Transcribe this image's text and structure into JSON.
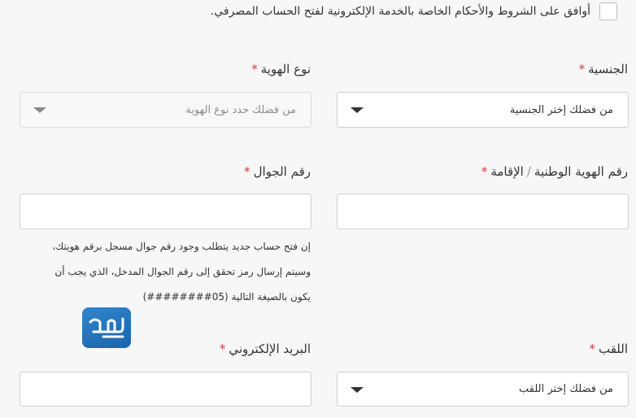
{
  "terms": {
    "text": "أوافق على الشروط والأحكام الخاصة بالخدمة الإلكترونية لفتح الحساب المصرفي."
  },
  "nationality": {
    "label": "الجنسية",
    "required_mark": "*",
    "placeholder": "من فضلك إختر الجنسية"
  },
  "id_type": {
    "label": "نوع الهوية",
    "required_mark": "*",
    "placeholder": "من فضلك حدد نوع الهوية"
  },
  "national_id": {
    "label_part1": "رقم الهوية الوطنية",
    "separator": "/",
    "label_part2": "الإقامة",
    "required_mark": "*",
    "value": ""
  },
  "mobile": {
    "label": "رقم الجوال",
    "required_mark": "*",
    "value": "",
    "note_line1": "إن فتح حساب جديد يتطلب وجود رقم جوال مسجل برقم هويتك،",
    "note_line2": "وسيتم إرسال رمز تحقق إلى رقم الجوال المدخل، الذي يجب أن",
    "note_line3": "يكون بالصيغة التالية  (05########)"
  },
  "title_field": {
    "label": "اللقب",
    "required_mark": "*",
    "placeholder": "من فضلك إختر اللقب"
  },
  "email": {
    "label": "البريد الإلكتروني",
    "required_mark": "*",
    "value": ""
  },
  "colors": {
    "required": "#d9363e",
    "logo_blue": "#1f6fb8"
  }
}
